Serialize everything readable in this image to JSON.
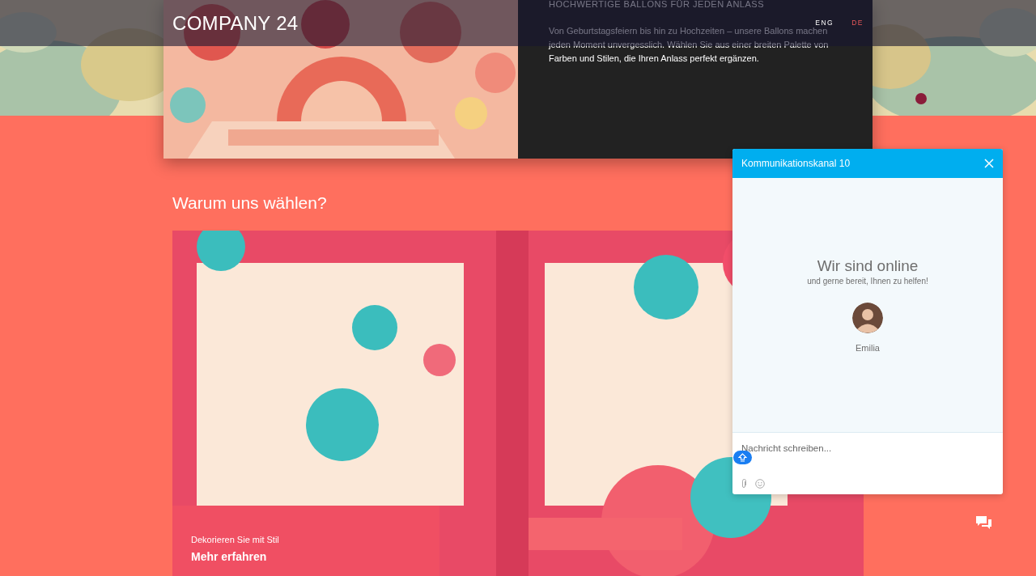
{
  "header": {
    "logo": "COMPANY 24",
    "languages": [
      {
        "label": "ENG",
        "selected": false
      },
      {
        "label": "DE",
        "selected": true
      }
    ]
  },
  "hero": {
    "heading": "HOCHWERTIGE BALLONS FÜR JEDEN ANLASS",
    "text": "Von Geburtstagsfeiern bis hin zu Hochzeiten – unsere Ballons machen jeden Moment unvergesslich. Wählen Sie aus einer breiten Palette von Farben und Stilen, die Ihren Anlass perfekt ergänzen."
  },
  "section": {
    "title": "Warum uns wählen?",
    "slide": {
      "caption": "Dekorieren Sie mit Stil",
      "link": "Mehr erfahren"
    }
  },
  "chat": {
    "title": "Kommunikationskanal 10",
    "headline": "Wir sind online",
    "subline": "und gerne bereit, Ihnen zu helfen!",
    "agent": "Emilia",
    "placeholder": "Nachricht schreiben..."
  }
}
